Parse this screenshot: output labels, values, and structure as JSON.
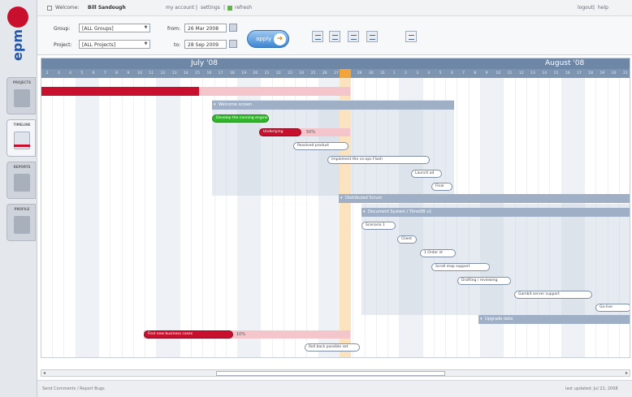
{
  "app": {
    "brand": "epm"
  },
  "topbar": {
    "welcome_prefix": "Welcome:",
    "user_name": "Bill Sandough",
    "my_account": "my account",
    "settings": "settings",
    "refresh": "refresh",
    "sep": "|",
    "logout": "logout",
    "help": "help"
  },
  "sidebar": {
    "items": [
      {
        "label": "PROJECTS"
      },
      {
        "label": "TIMELINE"
      },
      {
        "label": "REPORTS"
      },
      {
        "label": "PROFILE"
      }
    ]
  },
  "filters": {
    "group_label": "Group:",
    "group_value": "[ALL Groups]",
    "project_label": "Project:",
    "project_value": "[ALL Projects]",
    "from_label": "from:",
    "from_value": "26 Mar 2008",
    "to_label": "to:",
    "to_value": "28 Sep 2009",
    "apply_label": "apply",
    "apply_icon": "arrow-right-icon"
  },
  "timeline": {
    "months": [
      {
        "name": "July '08"
      },
      {
        "name": "August '08"
      }
    ],
    "days": [
      "2",
      "3",
      "4",
      "5",
      "6",
      "7",
      "8",
      "9",
      "10",
      "11",
      "12",
      "13",
      "14",
      "15",
      "16",
      "17",
      "18",
      "19",
      "20",
      "21",
      "22",
      "23",
      "24",
      "25",
      "26",
      "27",
      "28",
      "29",
      "30",
      "31",
      "1",
      "2",
      "3",
      "4",
      "5",
      "6",
      "7",
      "8",
      "9",
      "10",
      "11",
      "12",
      "13",
      "14",
      "15",
      "16",
      "17",
      "18",
      "19",
      "20",
      "21"
    ],
    "groups": [
      {
        "label": "Welcome screen"
      },
      {
        "label": "Distributed Scrum"
      },
      {
        "label": "Document System / TimeDB v1"
      },
      {
        "label": "Upgrade data"
      }
    ],
    "tasks": [
      {
        "label": "Develop the canning engine"
      },
      {
        "label": "Underlying",
        "pct": "50%"
      },
      {
        "label": "Resolved product"
      },
      {
        "label": "Implement the co-ops Flash"
      },
      {
        "label": "Launch ad"
      },
      {
        "label": "Final"
      },
      {
        "label": "Scenario 1"
      },
      {
        "label": "Client"
      },
      {
        "label": "1 Order id"
      },
      {
        "label": "Scroll map support"
      },
      {
        "label": "Drafting / reviewing"
      },
      {
        "label": "Gambit server support"
      },
      {
        "label": "Go-live"
      },
      {
        "label": "Find new business cases",
        "pct": "10%"
      },
      {
        "label": "Roll back possible set"
      }
    ]
  },
  "footer": {
    "left": "Send Comments / Report Bugs",
    "right": "last updated: Jul 22, 2008"
  }
}
